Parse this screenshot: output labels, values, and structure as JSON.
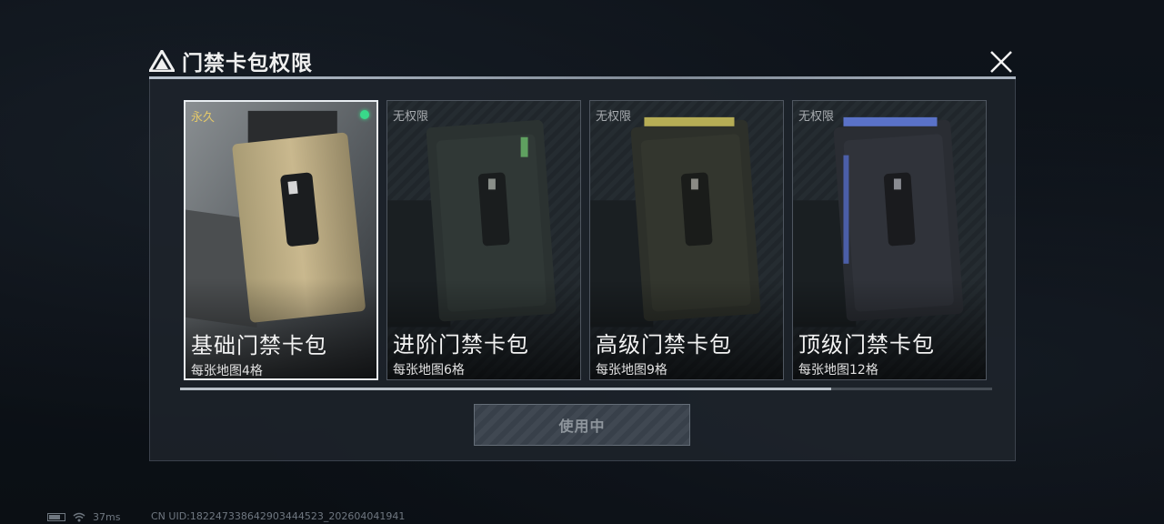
{
  "window": {
    "title": "门禁卡包权限"
  },
  "cards": [
    {
      "status": "永久",
      "name": "基础门禁卡包",
      "desc": "每张地图4格",
      "selected": true,
      "accent": "#c9b88e"
    },
    {
      "status": "无权限",
      "name": "进阶门禁卡包",
      "desc": "每张地图6格",
      "selected": false,
      "accent": "#5fa060"
    },
    {
      "status": "无权限",
      "name": "高级门禁卡包",
      "desc": "每张地图9格",
      "selected": false,
      "accent": "#b6ad55"
    },
    {
      "status": "无权限",
      "name": "顶级门禁卡包",
      "desc": "每张地图12格",
      "selected": false,
      "accent": "#5a72c8"
    }
  ],
  "action": {
    "label": "使用中"
  },
  "status_bar": {
    "ping": "37ms",
    "uid": "CN UID:18224733864290344​4523_202604041941"
  },
  "colors": {
    "active_dot": "#39d98a",
    "permanent_text": "#e3c86a",
    "selected_border": "#e9eef2"
  }
}
